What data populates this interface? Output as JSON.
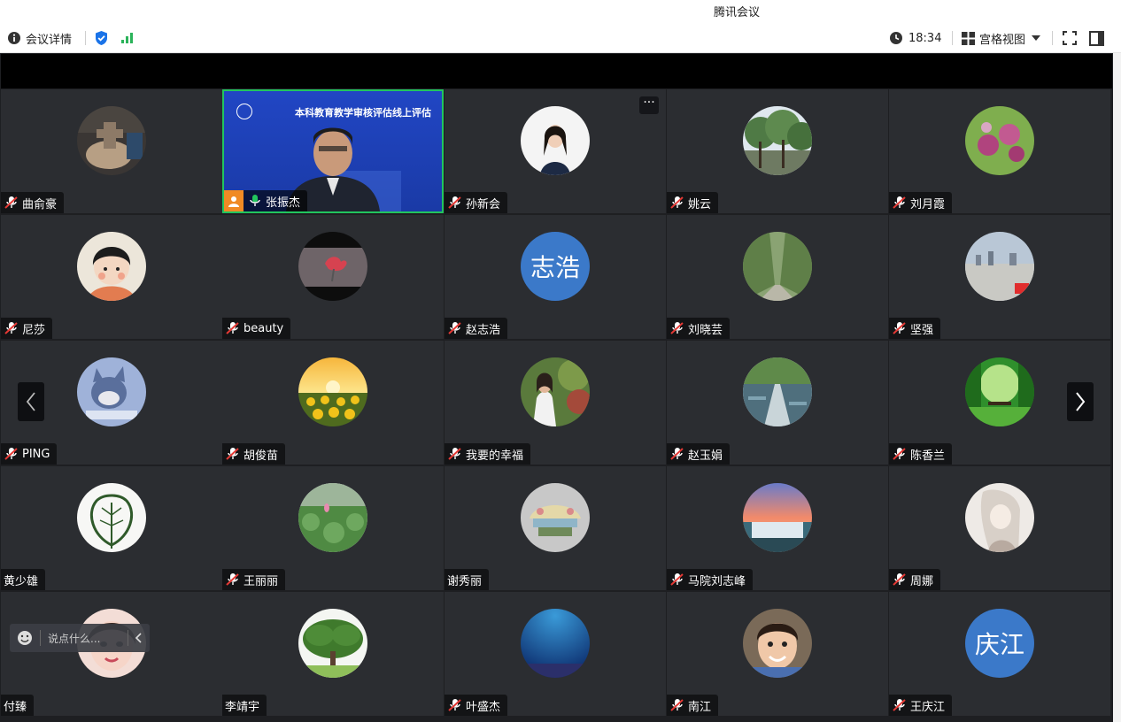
{
  "window": {
    "title": "腾讯会议"
  },
  "toolbar": {
    "meeting_info": "会议详情",
    "time": "18:34",
    "view_mode": "宫格视图"
  },
  "colors": {
    "tile_bg": "#2b2d31",
    "speaker_border": "#22c55e",
    "text_avatar": "#3b79c9"
  },
  "main_speaker": {
    "name": "张振杰",
    "slide_title": "本科教育教学审核评估线上评估",
    "muted": false
  },
  "participants": [
    {
      "name": "曲俞豪",
      "muted": true,
      "avatar": "photo-doll"
    },
    {
      "name": "张振杰",
      "muted": false,
      "avatar": "video"
    },
    {
      "name": "孙新会",
      "muted": true,
      "avatar": "photo-woman"
    },
    {
      "name": "姚云",
      "muted": true,
      "avatar": "photo-trees"
    },
    {
      "name": "刘月霞",
      "muted": true,
      "avatar": "photo-flowers"
    },
    {
      "name": "尼莎",
      "muted": true,
      "avatar": "cartoon-girl"
    },
    {
      "name": "beauty",
      "muted": true,
      "avatar": "photo-rose"
    },
    {
      "name": "赵志浩",
      "muted": true,
      "avatar_text": "志浩"
    },
    {
      "name": "刘晓芸",
      "muted": true,
      "avatar": "photo-avenue"
    },
    {
      "name": "坚强",
      "muted": true,
      "avatar": "photo-city"
    },
    {
      "name": "PING",
      "muted": true,
      "avatar": "cartoon-cat"
    },
    {
      "name": "胡俊苗",
      "muted": true,
      "avatar": "photo-sunflowers"
    },
    {
      "name": "我要的幸福",
      "muted": true,
      "avatar": "photo-person"
    },
    {
      "name": "赵玉娟",
      "muted": true,
      "avatar": "photo-lake"
    },
    {
      "name": "陈香兰",
      "muted": true,
      "avatar": "photo-forest"
    },
    {
      "name": "黄少雄",
      "muted": false,
      "avatar": "leaf-drawing"
    },
    {
      "name": "王丽丽",
      "muted": true,
      "avatar": "photo-lotus"
    },
    {
      "name": "谢秀丽",
      "muted": false,
      "avatar": "drawing-sign"
    },
    {
      "name": "马院刘志峰",
      "muted": true,
      "avatar": "photo-waterfall"
    },
    {
      "name": "周娜",
      "muted": true,
      "avatar": "anime-sketch"
    },
    {
      "name": "付臻",
      "muted": false,
      "avatar": "photo-face"
    },
    {
      "name": "李靖宇",
      "muted": false,
      "avatar": "photo-tree"
    },
    {
      "name": "叶盛杰",
      "muted": true,
      "avatar": "photo-sea"
    },
    {
      "name": "南江",
      "muted": true,
      "avatar": "photo-child"
    },
    {
      "name": "王庆江",
      "muted": true,
      "avatar_text": "庆江"
    }
  ],
  "chat": {
    "placeholder": "说点什么..."
  }
}
